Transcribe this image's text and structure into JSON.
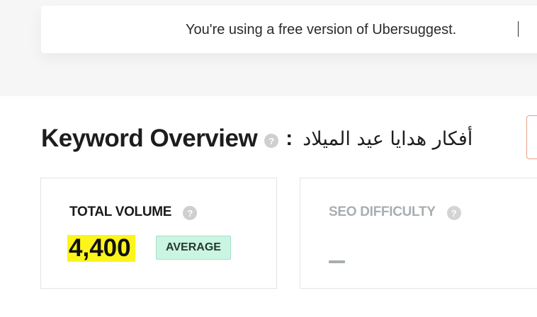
{
  "banner": {
    "text": "You're using a free version of Ubersuggest."
  },
  "overview": {
    "title": "Keyword Overview",
    "help_icon": "question-icon",
    "separator": ":",
    "keyword": "أفكار هدايا عيد الميلاد"
  },
  "cards": {
    "total_volume": {
      "label": "TOTAL VOLUME",
      "help_icon": "question-icon",
      "value": "4,400",
      "badge": "AVERAGE",
      "badge_color": "#cbf5e3",
      "highlight_color": "#fbf51b"
    },
    "seo_difficulty": {
      "label": "SEO DIFFICULTY",
      "help_icon": "question-icon",
      "value": "—"
    }
  }
}
